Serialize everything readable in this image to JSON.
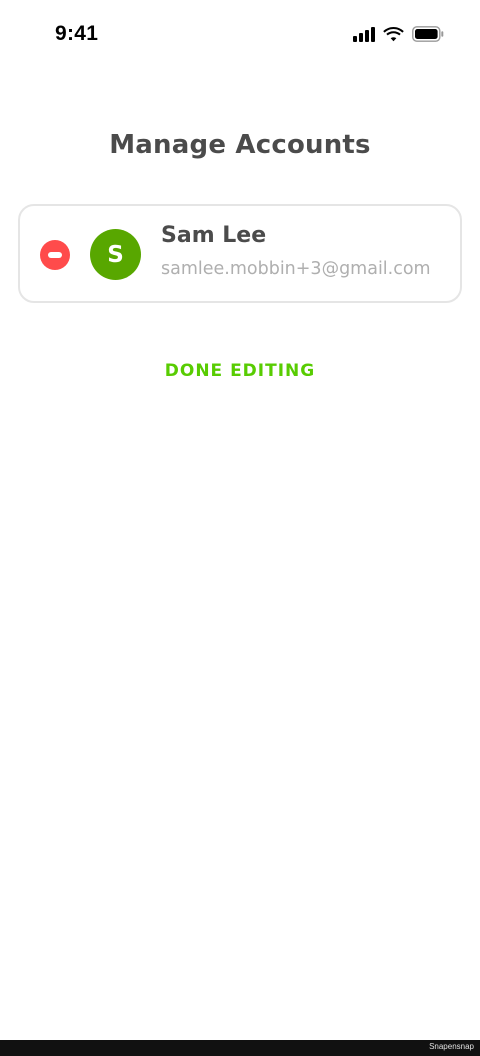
{
  "status_bar": {
    "time": "9:41",
    "icons": [
      "cellular-signal-icon",
      "wifi-icon",
      "battery-icon"
    ]
  },
  "page": {
    "title": "Manage Accounts"
  },
  "accounts": [
    {
      "initial": "S",
      "name": "Sam Lee",
      "email": "samlee.mobbin+3@gmail.com",
      "remove_icon": "minus-circle-icon"
    }
  ],
  "actions": {
    "done_label": "DONE EDITING"
  },
  "footer": {
    "watermark": "Snapensnap"
  },
  "colors": {
    "title_text": "#4b4b4b",
    "secondary_text": "#afafaf",
    "accent_green": "#58cc02",
    "avatar_green": "#58a700",
    "remove_red": "#ff4b4b",
    "card_border": "#e5e5e5"
  }
}
